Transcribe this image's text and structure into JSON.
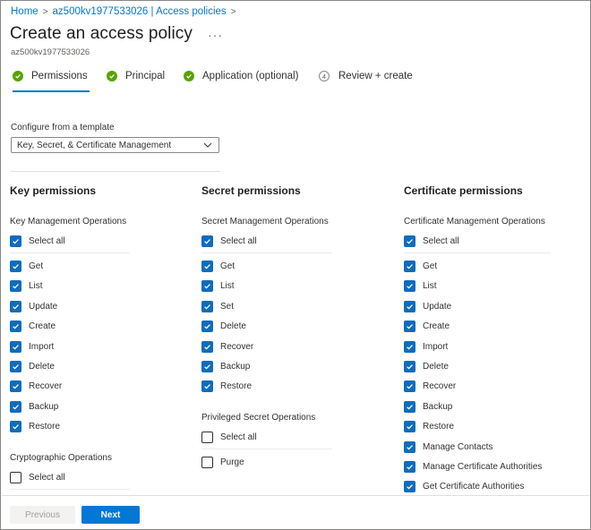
{
  "breadcrumb": {
    "home": "Home",
    "parent": "az500kv1977533026 | Access policies"
  },
  "header": {
    "title": "Create an access policy",
    "more": "···",
    "subtitle": "az500kv1977533026"
  },
  "steps": [
    {
      "label": "Permissions",
      "state": "complete",
      "active": true
    },
    {
      "label": "Principal",
      "state": "complete"
    },
    {
      "label": "Application (optional)",
      "state": "complete"
    },
    {
      "label": "Review + create",
      "state": "pending",
      "number": "4"
    }
  ],
  "template": {
    "label": "Configure from a template",
    "value": "Key, Secret, & Certificate Management"
  },
  "key": {
    "title": "Key permissions",
    "mgmt_label": "Key Management Operations",
    "select_all": "Select all",
    "mgmt_items": [
      "Get",
      "List",
      "Update",
      "Create",
      "Import",
      "Delete",
      "Recover",
      "Backup",
      "Restore"
    ],
    "crypto_label": "Cryptographic Operations",
    "crypto_select_all": "Select all"
  },
  "secret": {
    "title": "Secret permissions",
    "mgmt_label": "Secret Management Operations",
    "select_all": "Select all",
    "mgmt_items": [
      "Get",
      "List",
      "Set",
      "Delete",
      "Recover",
      "Backup",
      "Restore"
    ],
    "priv_label": "Privileged Secret Operations",
    "priv_select_all": "Select all",
    "priv_items": [
      "Purge"
    ]
  },
  "certificate": {
    "title": "Certificate permissions",
    "mgmt_label": "Certificate Management Operations",
    "select_all": "Select all",
    "mgmt_items": [
      "Get",
      "List",
      "Update",
      "Create",
      "Import",
      "Delete",
      "Recover",
      "Backup",
      "Restore",
      "Manage Contacts",
      "Manage Certificate Authorities",
      "Get Certificate Authorities"
    ]
  },
  "footer": {
    "previous": "Previous",
    "next": "Next"
  },
  "colors": {
    "accent": "#0078d4",
    "checkbox": "#0f6cbd",
    "success": "#57a300"
  }
}
